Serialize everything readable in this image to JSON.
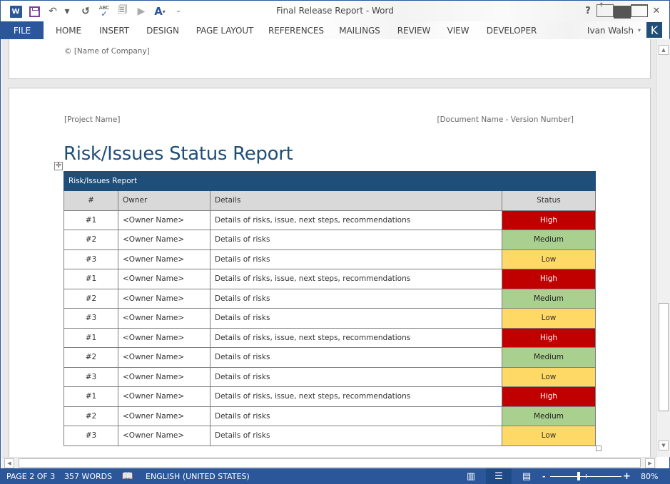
{
  "window": {
    "title": "Final Release Report - Word",
    "controls": {
      "help": "?",
      "ribbon_options": "ribbon-display-options",
      "minimize": "minimize",
      "maximize": "maximize",
      "close": "✕"
    }
  },
  "quick_access": {
    "icons": [
      "word-logo",
      "save",
      "undo",
      "redo",
      "spelling-grammar",
      "new-comment",
      "reply",
      "text-effects",
      "customize-qat"
    ],
    "word_logo_letter": "W",
    "abc_label": "ABC"
  },
  "ribbon": {
    "tabs": [
      "FILE",
      "HOME",
      "INSERT",
      "DESIGN",
      "PAGE LAYOUT",
      "REFERENCES",
      "MAILINGS",
      "REVIEW",
      "VIEW",
      "DEVELOPER"
    ],
    "active_tab": "FILE",
    "user_name": "Ivan Walsh",
    "avatar_letter": "K"
  },
  "document": {
    "prev_page_footer": "© [Name of Company]",
    "header_left": "[Project Name]",
    "header_right": "[Document Name - Version Number]",
    "title": "Risk/Issues Status Report",
    "table": {
      "caption": "Risk/Issues Report",
      "columns": [
        "#",
        "Owner",
        "Details",
        "Status"
      ],
      "rows": [
        {
          "num": "#1",
          "owner": "<Owner Name>",
          "details": "Details of risks, issue, next steps, recommendations",
          "status": "High"
        },
        {
          "num": "#2",
          "owner": "<Owner Name>",
          "details": "Details of risks",
          "status": "Medium"
        },
        {
          "num": "#3",
          "owner": "<Owner Name>",
          "details": "Details of risks",
          "status": "Low"
        },
        {
          "num": "#1",
          "owner": "<Owner Name>",
          "details": "Details of risks, issue, next steps, recommendations",
          "status": "High"
        },
        {
          "num": "#2",
          "owner": "<Owner Name>",
          "details": "Details of risks",
          "status": "Medium"
        },
        {
          "num": "#3",
          "owner": "<Owner Name>",
          "details": "Details of risks",
          "status": "Low"
        },
        {
          "num": "#1",
          "owner": "<Owner Name>",
          "details": "Details of risks, issue, next steps, recommendations",
          "status": "High"
        },
        {
          "num": "#2",
          "owner": "<Owner Name>",
          "details": "Details of risks",
          "status": "Medium"
        },
        {
          "num": "#3",
          "owner": "<Owner Name>",
          "details": "Details of risks",
          "status": "Low"
        },
        {
          "num": "#1",
          "owner": "<Owner Name>",
          "details": "Details of risks, issue, next steps, recommendations",
          "status": "High"
        },
        {
          "num": "#2",
          "owner": "<Owner Name>",
          "details": "Details of risks",
          "status": "Medium"
        },
        {
          "num": "#3",
          "owner": "<Owner Name>",
          "details": "Details of risks",
          "status": "Low"
        }
      ],
      "status_colors": {
        "High": "#c00000",
        "Medium": "#a9d08e",
        "Low": "#ffd966"
      }
    }
  },
  "statusbar": {
    "page": "PAGE 2 OF 3",
    "words": "357 WORDS",
    "language": "ENGLISH (UNITED STATES)",
    "zoom": "80%",
    "zoom_minus": "-",
    "zoom_plus": "+",
    "active_view": "print-layout"
  },
  "colors": {
    "accent": "#2b579a",
    "title": "#1f4e79",
    "table_caption": "#1f4e79",
    "table_header": "#d9d9d9"
  }
}
